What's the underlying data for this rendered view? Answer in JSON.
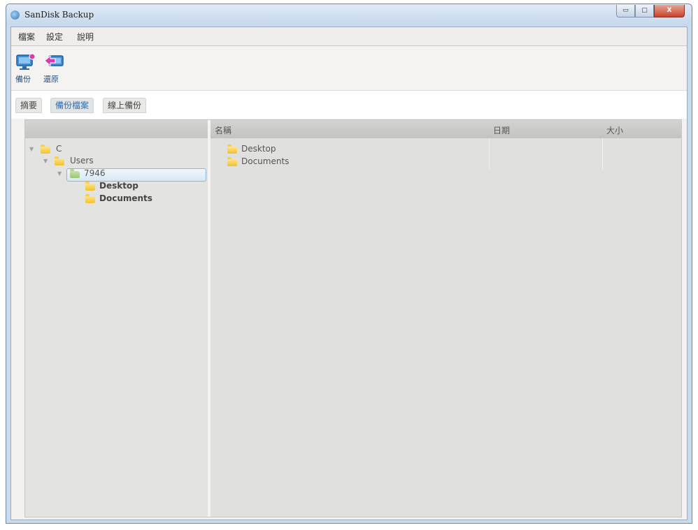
{
  "window": {
    "title": "SanDisk Backup",
    "controls": {
      "minimize": "▭",
      "maximize": "▢",
      "close": "X"
    }
  },
  "menubar": {
    "items": [
      "檔案",
      "設定",
      "說明"
    ]
  },
  "toolbar": {
    "backup_label": "備份",
    "restore_label": "還原",
    "backup_icon": "monitor-icon",
    "restore_icon": "restore-arrow-icon"
  },
  "tabs": [
    {
      "label": "摘要",
      "active": false
    },
    {
      "label": "備份檔案",
      "active": true
    },
    {
      "label": "線上備份",
      "active": false
    }
  ],
  "tree": {
    "nodes": [
      {
        "label": "C",
        "level": 0,
        "expanded": true
      },
      {
        "label": "Users",
        "level": 1,
        "expanded": true
      },
      {
        "label": "7946",
        "level": 2,
        "expanded": true,
        "selected": true
      },
      {
        "label": "Desktop",
        "level": 3,
        "bold": true
      },
      {
        "label": "Documents",
        "level": 3,
        "bold": true
      }
    ]
  },
  "file_list": {
    "columns": [
      "名稱",
      "日期",
      "大小"
    ],
    "rows": [
      {
        "name": "Desktop",
        "date": "",
        "size": ""
      },
      {
        "name": "Documents",
        "date": "",
        "size": ""
      }
    ]
  },
  "colors": {
    "accent_tab": "#2f6ea8",
    "folder_yellow": "#f2c22b",
    "folder_green": "#98c675",
    "close_button": "#c7432c"
  }
}
